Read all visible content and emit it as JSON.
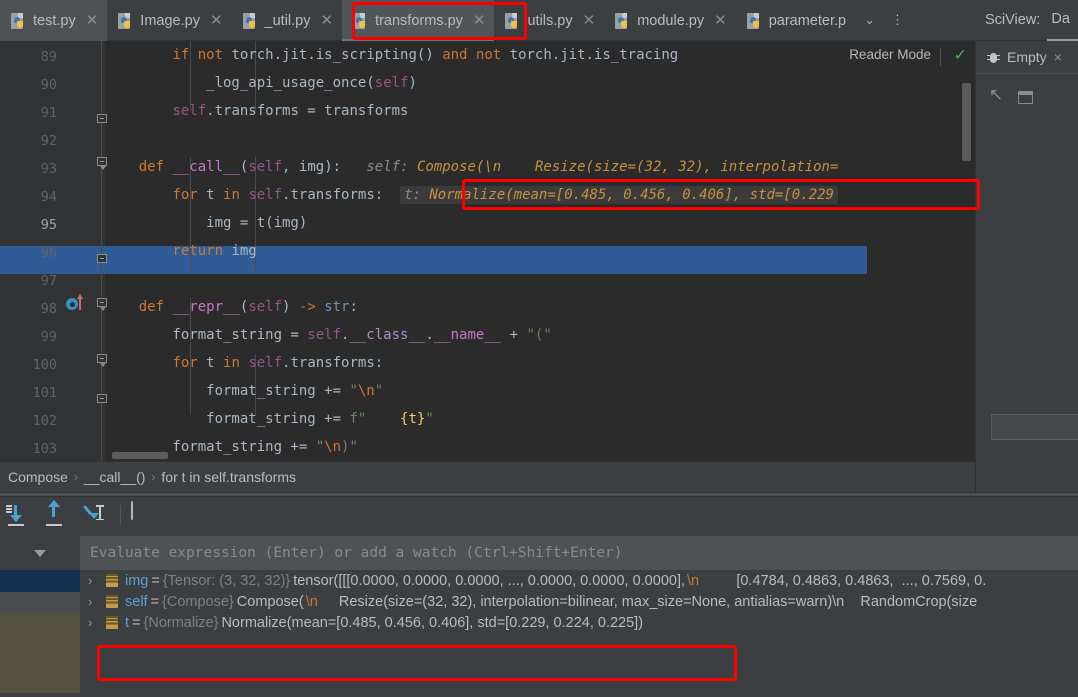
{
  "tabs": [
    {
      "label": "test.py",
      "icon": "python-file-icon",
      "active": false
    },
    {
      "label": "Image.py",
      "icon": "python-file-icon",
      "active": false
    },
    {
      "label": "_util.py",
      "icon": "python-file-icon",
      "active": false
    },
    {
      "label": "transforms.py",
      "icon": "python-file-icon",
      "active": true
    },
    {
      "label": "utils.py",
      "icon": "python-file-icon",
      "active": false
    },
    {
      "label": "module.py",
      "icon": "python-file-icon",
      "active": false
    },
    {
      "label": "parameter.p",
      "icon": "python-file-icon",
      "active": false
    }
  ],
  "tabbar_controls": {
    "chevron_label": "⌄",
    "chevron_icon": "chevron-down-icon",
    "more_label": "⋮",
    "more_icon": "more-vertical-icon"
  },
  "editor": {
    "reader_mode_label": "Reader Mode",
    "inspection_status_icon": "inspection-ok-check-icon",
    "line_numbers": [
      "89",
      "90",
      "91",
      "92",
      "93",
      "94",
      "95",
      "96",
      "97",
      "98",
      "99",
      "100",
      "101",
      "102",
      "103"
    ],
    "lines": {
      "l89": "if not torch.jit.is_scripting() and not torch.jit.is_tracing",
      "l90": "_log_api_usage_once(self)",
      "l91": "self.transforms = transforms",
      "l92": "",
      "l93": "def __call__(self, img):",
      "l93_hint_name": "self:",
      "l93_hint_value": "Compose(\\n    Resize(size=(32, 32), interpolation=",
      "l94": "for t in self.transforms:",
      "l94_hint_name": "t:",
      "l94_hint_value": "Normalize(mean=[0.485, 0.456, 0.406], std=[0.229",
      "l95": "img = t(img)",
      "l96": "return img",
      "l97": "",
      "l98": "def __repr__(self) -> str:",
      "l99": "format_string = self.__class__.__name__ + \"(\"",
      "l100": "for t in self.transforms:",
      "l101": "format_string += \"\\n\"",
      "l102": "format_string += f\"    {t}\"",
      "l103": "format_string += \"\\n)\""
    },
    "breakpoint_line": "98",
    "current_line": "95"
  },
  "breadcrumb": {
    "items": [
      "Compose",
      "__call__()",
      "for t in self.transforms"
    ],
    "separator": "›"
  },
  "sciview": {
    "title": "SciView:",
    "tab_label": "Da",
    "subtab_label": "Empty",
    "subtab_icon": "bug-icon",
    "subtab_close": "×",
    "tool_icons": [
      "open-externally-icon",
      "restore-window-icon"
    ]
  },
  "debugger": {
    "toolbar": [
      {
        "name": "step-into-icon",
        "title": "Step Into"
      },
      {
        "name": "step-out-icon",
        "title": "Step Out"
      },
      {
        "name": "step-into-my-code-icon",
        "title": "Step Into My Code"
      },
      {
        "name": "evaluate-expression-icon",
        "title": "Evaluate Expression"
      }
    ],
    "evaluate_placeholder": "Evaluate expression (Enter) or add a watch (Ctrl+Shift+Enter)",
    "evaluate_value": "",
    "dropdown_icon": "chevron-down-icon",
    "variables": [
      {
        "expander": "›",
        "icon": "variable-icon",
        "name": "img",
        "eq": " = ",
        "type": "{Tensor: (3, 32, 32)}",
        "value_pre": " tensor([[[0.0000, 0.0000, 0.0000,  ..., 0.0000, 0.0000, 0.0000],",
        "escape": "\\n",
        "value_post": "        [0.4784, 0.4863, 0.4863,  ..., 0.7569, 0.",
        "selected": false
      },
      {
        "expander": "›",
        "icon": "variable-icon",
        "name": "self",
        "eq": " = ",
        "type": "{Compose}",
        "value_pre": " Compose(",
        "escape": "\\n",
        "value_post": "    Resize(size=(32, 32), interpolation=bilinear, max_size=None, antialias=warn)\\n    RandomCrop(size",
        "selected": false
      },
      {
        "expander": "›",
        "icon": "variable-icon",
        "name": "t",
        "eq": " = ",
        "type": "{Normalize}",
        "value_pre": " Normalize(mean=[0.485, 0.456, 0.406], std=[0.229, 0.224, 0.225])",
        "escape": "",
        "value_post": "",
        "selected": true
      }
    ]
  },
  "annotations": {
    "highlight_color": "#fe0000",
    "boxes": [
      "active-tab-transforms-py",
      "inline-hint-normalize",
      "variable-row-t-normalize"
    ]
  }
}
